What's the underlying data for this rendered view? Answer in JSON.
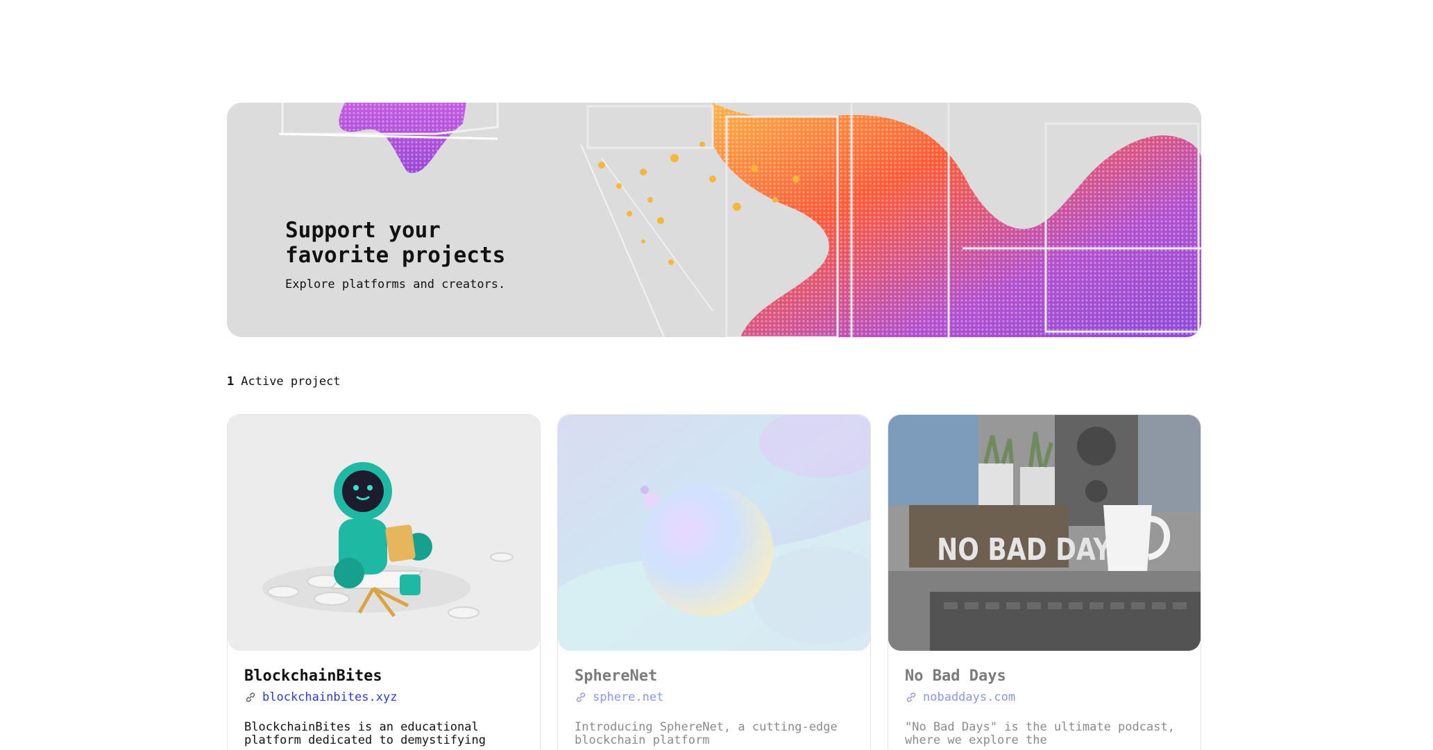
{
  "hero": {
    "title": "Support your\nfavorite projects",
    "subtitle": "Explore platforms and creators."
  },
  "projects_summary": {
    "count": "1",
    "label": "Active project"
  },
  "cards": [
    {
      "title": "BlockchainBites",
      "link": "blockchainbites.xyz",
      "description": "BlockchainBites is an educational platform dedicated to demystifying",
      "link_icon": "link-icon",
      "active": true
    },
    {
      "title": "SphereNet",
      "link": "sphere.net",
      "description": "Introducing SphereNet, a cutting-edge blockchain platform",
      "link_icon": "link-icon",
      "active": false
    },
    {
      "title": "No Bad Days",
      "link": "nobaddays.com",
      "description": "\"No Bad Days\" is the ultimate podcast, where we explore the",
      "image_sign_text": "NO BAD DAYS",
      "link_icon": "link-icon",
      "active": false
    }
  ],
  "colors": {
    "link_active": "#2a3bd6",
    "link_dim": "#8a95e6",
    "hero_bg": "#dcdcdc"
  }
}
